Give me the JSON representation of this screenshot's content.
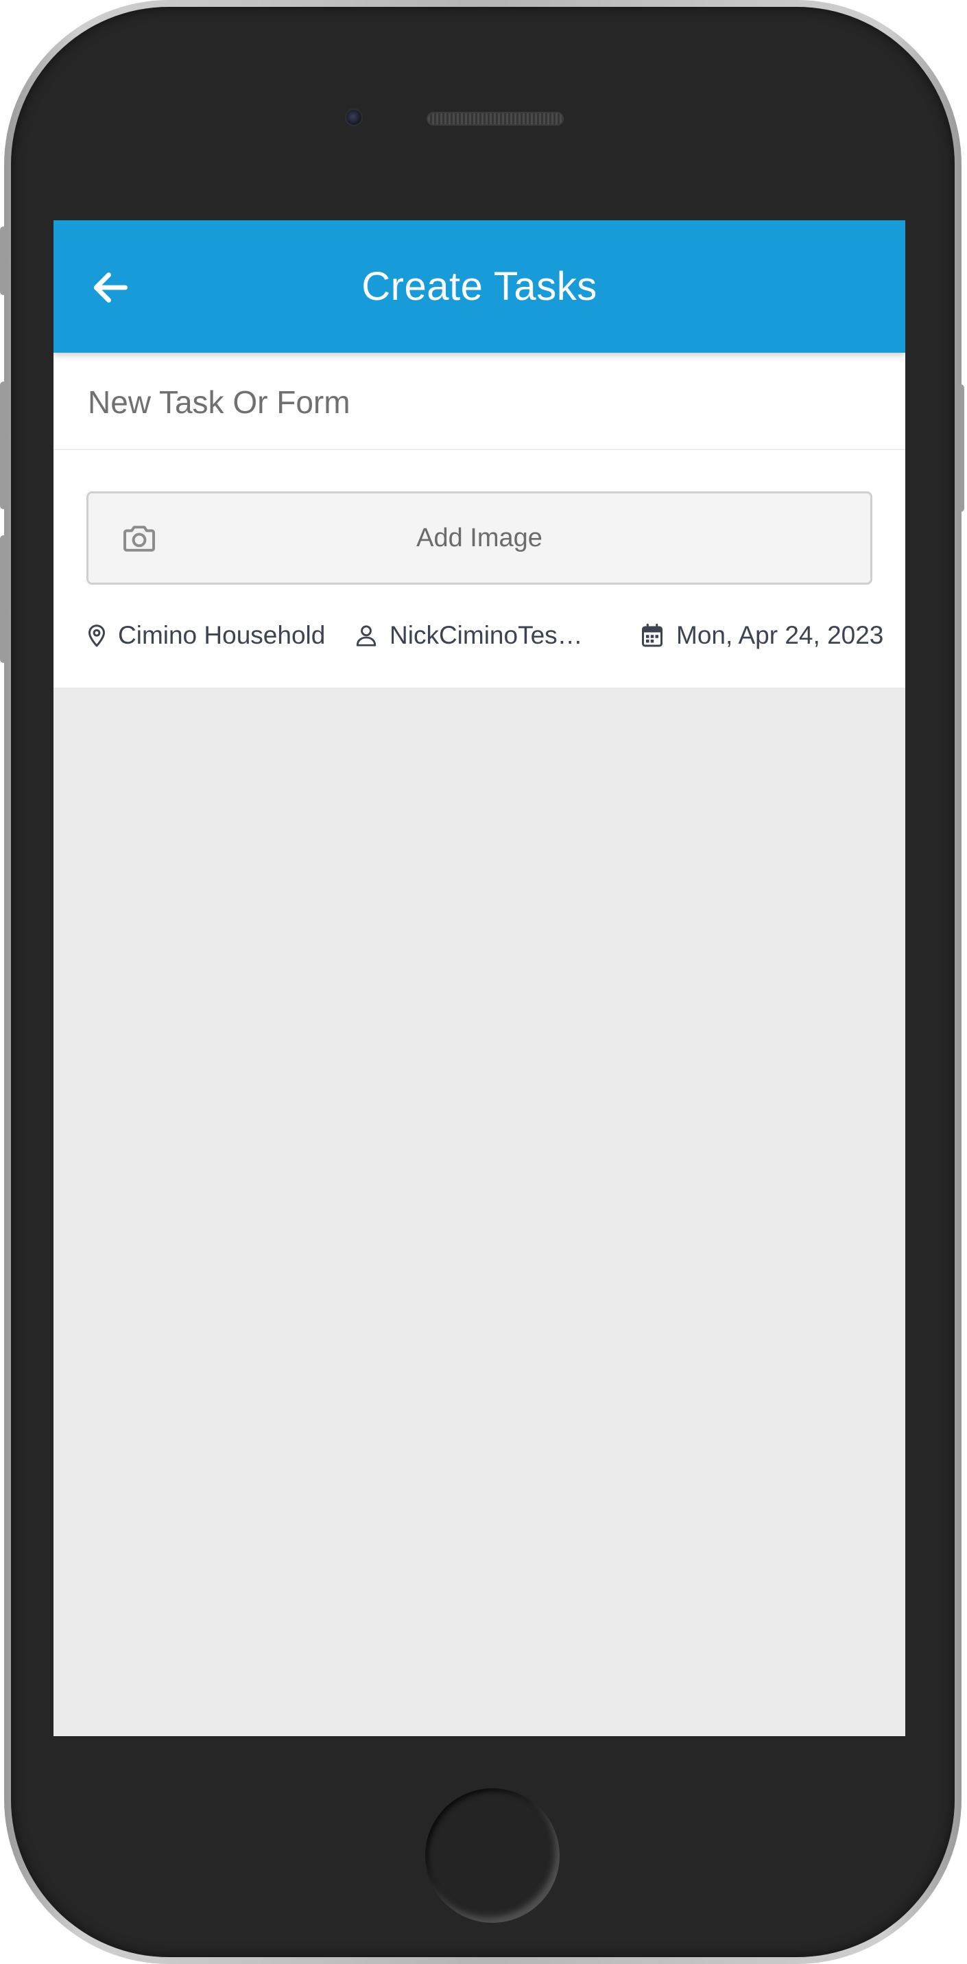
{
  "header": {
    "title": "Create Tasks",
    "back_icon": "arrow-left-icon"
  },
  "task_form": {
    "name_placeholder": "New Task Or Form",
    "name_value": "",
    "add_image_label": "Add Image",
    "add_image_icon": "camera-icon"
  },
  "meta": {
    "location": "Cimino Household",
    "location_icon": "map-pin-icon",
    "assignee": "NickCiminoTest …",
    "assignee_icon": "user-icon",
    "date": "Mon, Apr 24, 2023",
    "date_icon": "calendar-icon"
  },
  "colors": {
    "header_bg": "#179cd9",
    "content_bg": "#ebebeb",
    "meta_text": "#3d4350"
  }
}
